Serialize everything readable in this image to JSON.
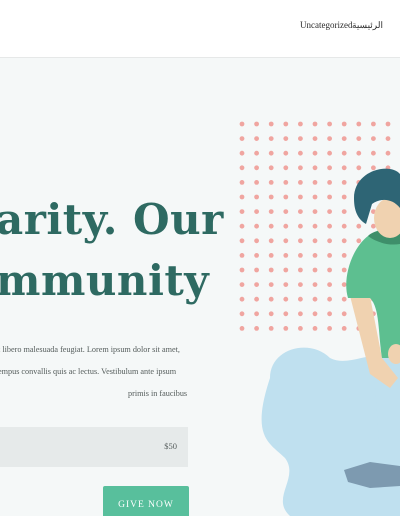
{
  "nav": {
    "items": [
      {
        "label": "Uncategorized"
      },
      {
        "label": "الرئيسية"
      }
    ]
  },
  "hero": {
    "headline_line1": "arity. Our",
    "headline_line2": "mmunity",
    "paragraph_lines": [
      "t libero malesuada feugiat.  Lorem ipsum dolor sit amet,",
      "empus convallis quis ac lectus.    Vestibulum ante ipsum",
      "primis in faucibus"
    ],
    "amount_value": "$50",
    "donate_label": "GIVE NOW"
  },
  "colors": {
    "headline": "#2e6a62",
    "button": "#58bf9c",
    "dots": "#f0a5a0",
    "blob": "#bfe0ef",
    "shirt": "#5dbf90"
  }
}
